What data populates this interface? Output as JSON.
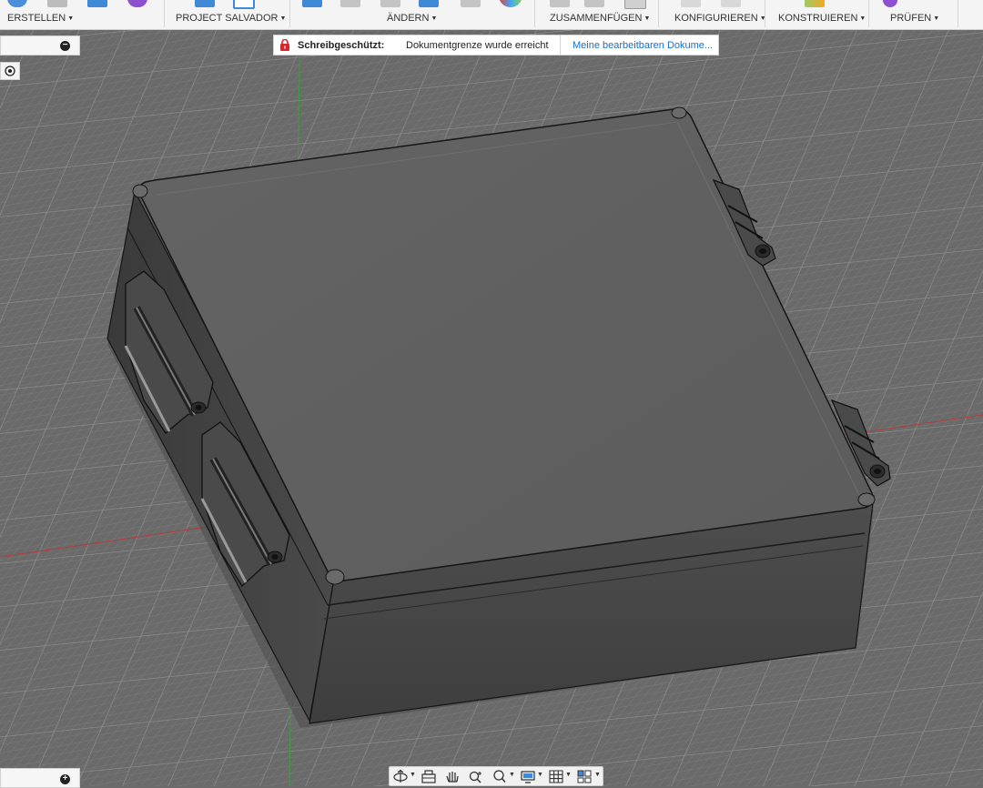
{
  "toolbar": {
    "groups": [
      {
        "label": "ERSTELLEN"
      },
      {
        "label": "PROJECT SALVADOR"
      },
      {
        "label": "ÄNDERN"
      },
      {
        "label": "ZUSAMMENFÜGEN"
      },
      {
        "label": "KONFIGURIEREN"
      },
      {
        "label": "KONSTRUIEREN"
      },
      {
        "label": "PRÜFEN"
      }
    ]
  },
  "notification": {
    "title": "Schreibgeschützt:",
    "message": "Dokumentgrenze wurde erreicht",
    "link": "Meine bearbeitbaren Dokume..."
  },
  "colors": {
    "notification_lock": "#d9262b",
    "link": "#1670c6",
    "grid_axis_red": "#b43c3c",
    "grid_axis_green": "#3ca03c",
    "model_body": "#5a5a5a"
  },
  "navbar": {
    "icons": [
      "orbit-icon",
      "look-at-icon",
      "pan-icon",
      "zoom-icon",
      "fit-icon",
      "display-settings-icon",
      "grid-settings-icon",
      "viewports-icon"
    ]
  }
}
